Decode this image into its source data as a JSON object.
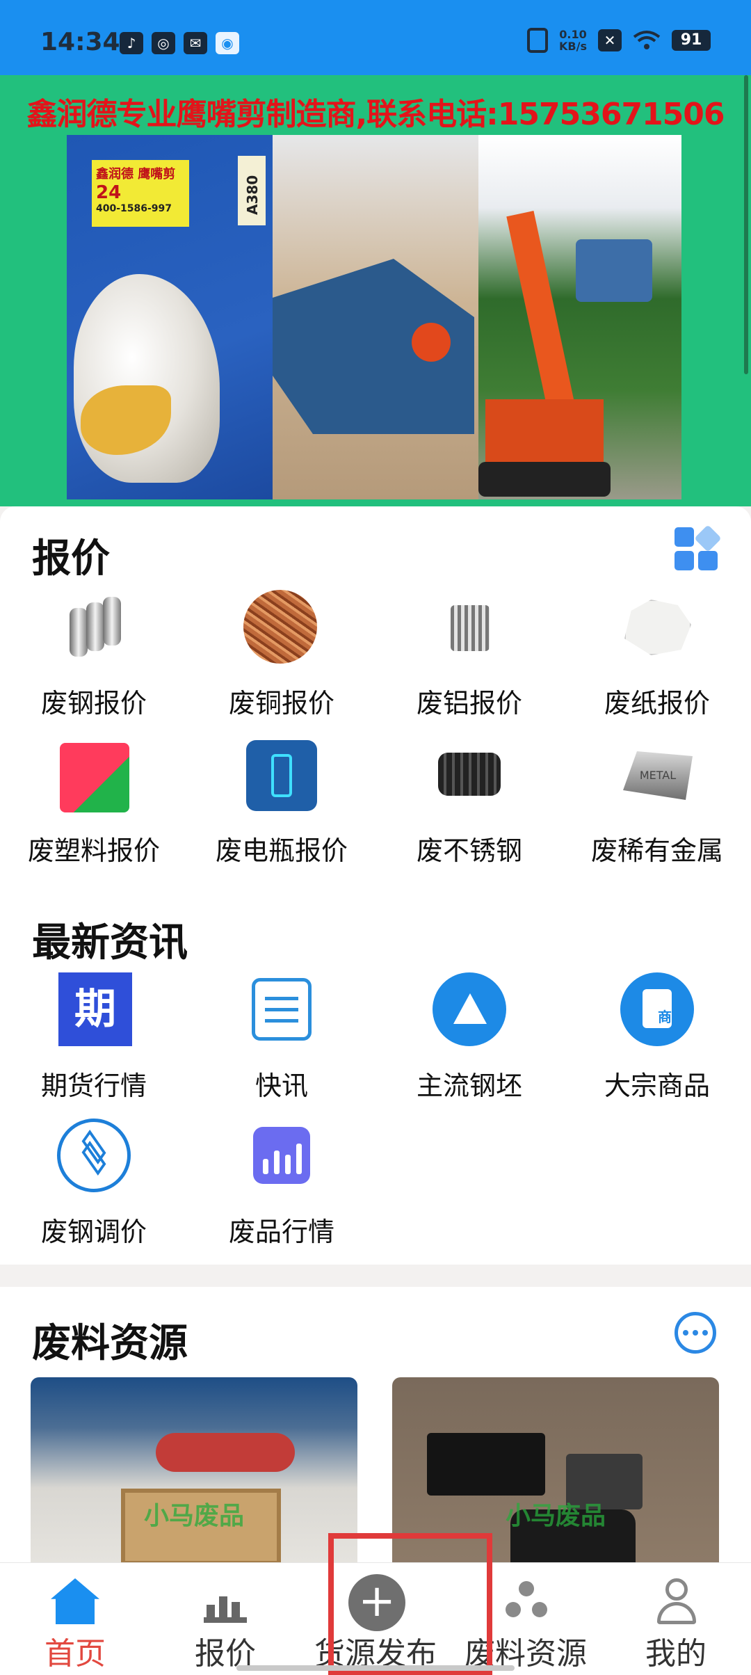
{
  "status_bar": {
    "time": "14:34",
    "net_speed_value": "0.10",
    "net_speed_unit": "KB/s",
    "battery": "91",
    "apps": [
      "tiktok-icon",
      "app-icon",
      "mail-icon",
      "baidu-icon"
    ]
  },
  "banner": {
    "headline": "鑫润德专业鹰嘴剪制造商,联系电话:15753671506",
    "sticker_text": "鑫润德 鹰嘴剪",
    "sticker_number": "24",
    "sticker_phone": "400-1586-997",
    "tag_text": "A380",
    "page_count": 2,
    "active_page": 2
  },
  "quotes": {
    "title": "报价",
    "items": [
      {
        "label": "废钢报价",
        "icon": "steel-pipes-icon"
      },
      {
        "label": "废铜报价",
        "icon": "copper-wire-icon"
      },
      {
        "label": "废铝报价",
        "icon": "aluminum-can-icon"
      },
      {
        "label": "废纸报价",
        "icon": "crumpled-paper-icon"
      },
      {
        "label": "废塑料报价",
        "icon": "plastic-icon"
      },
      {
        "label": "废电瓶报价",
        "icon": "battery-icon"
      },
      {
        "label": "废不锈钢",
        "icon": "stainless-parts-icon"
      },
      {
        "label": "废稀有金属",
        "icon": "metal-ingot-icon"
      }
    ]
  },
  "news": {
    "title": "最新资讯",
    "items": [
      {
        "label": "期货行情",
        "icon": "futures-icon",
        "glyph": "期"
      },
      {
        "label": "快讯",
        "icon": "news-flash-icon"
      },
      {
        "label": "主流钢坯",
        "icon": "steel-billet-icon"
      },
      {
        "label": "大宗商品",
        "icon": "commodity-icon",
        "glyph": "商"
      },
      {
        "label": "废钢调价",
        "icon": "layers-icon"
      },
      {
        "label": "废品行情",
        "icon": "bar-chart-icon"
      }
    ]
  },
  "resources": {
    "title": "废料资源",
    "watermark": "小马废品",
    "ingot_text": "METAL"
  },
  "nav": {
    "items": [
      {
        "label": "首页",
        "icon": "home-icon",
        "active": true
      },
      {
        "label": "报价",
        "icon": "chart-icon",
        "active": false
      },
      {
        "label": "货源发布",
        "icon": "plus-circle-icon",
        "active": false
      },
      {
        "label": "废料资源",
        "icon": "group-icon",
        "active": false
      },
      {
        "label": "我的",
        "icon": "user-icon",
        "active": false
      }
    ]
  },
  "colors": {
    "status_bar": "#1a8ff0",
    "banner_bg": "#22c07d",
    "banner_text": "#e3141a",
    "nav_active": "#e2483f",
    "highlight": "#e03a3a"
  }
}
